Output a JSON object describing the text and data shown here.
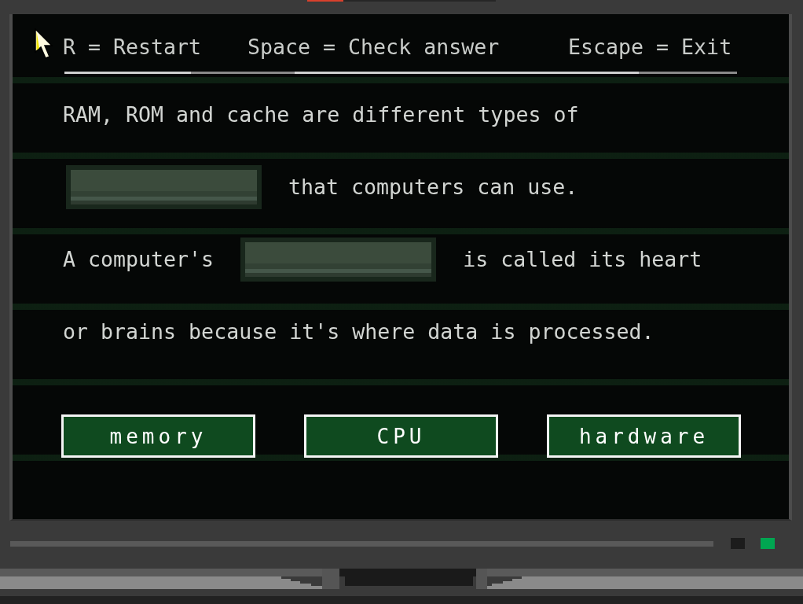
{
  "header": {
    "hints": [
      "R = Restart",
      "Space = Check answer",
      "Escape = Exit"
    ]
  },
  "question": {
    "lines": [
      {
        "segments": [
          {
            "kind": "text",
            "text": "RAM, ROM and cache are different types of"
          }
        ]
      },
      {
        "segments": [
          {
            "kind": "blank"
          },
          {
            "kind": "text",
            "text": "that computers can use."
          }
        ]
      },
      {
        "segments": [
          {
            "kind": "text",
            "text": "A computer's"
          },
          {
            "kind": "blank"
          },
          {
            "kind": "text",
            "text": "is called its heart"
          }
        ]
      },
      {
        "segments": [
          {
            "kind": "text",
            "text": "or brains because it's where data is processed."
          }
        ]
      }
    ]
  },
  "answers": [
    {
      "label": "memory"
    },
    {
      "label": "CPU"
    },
    {
      "label": "hardware"
    }
  ],
  "monitor": {
    "leds": [
      {
        "on": false
      },
      {
        "on": true
      }
    ]
  }
}
